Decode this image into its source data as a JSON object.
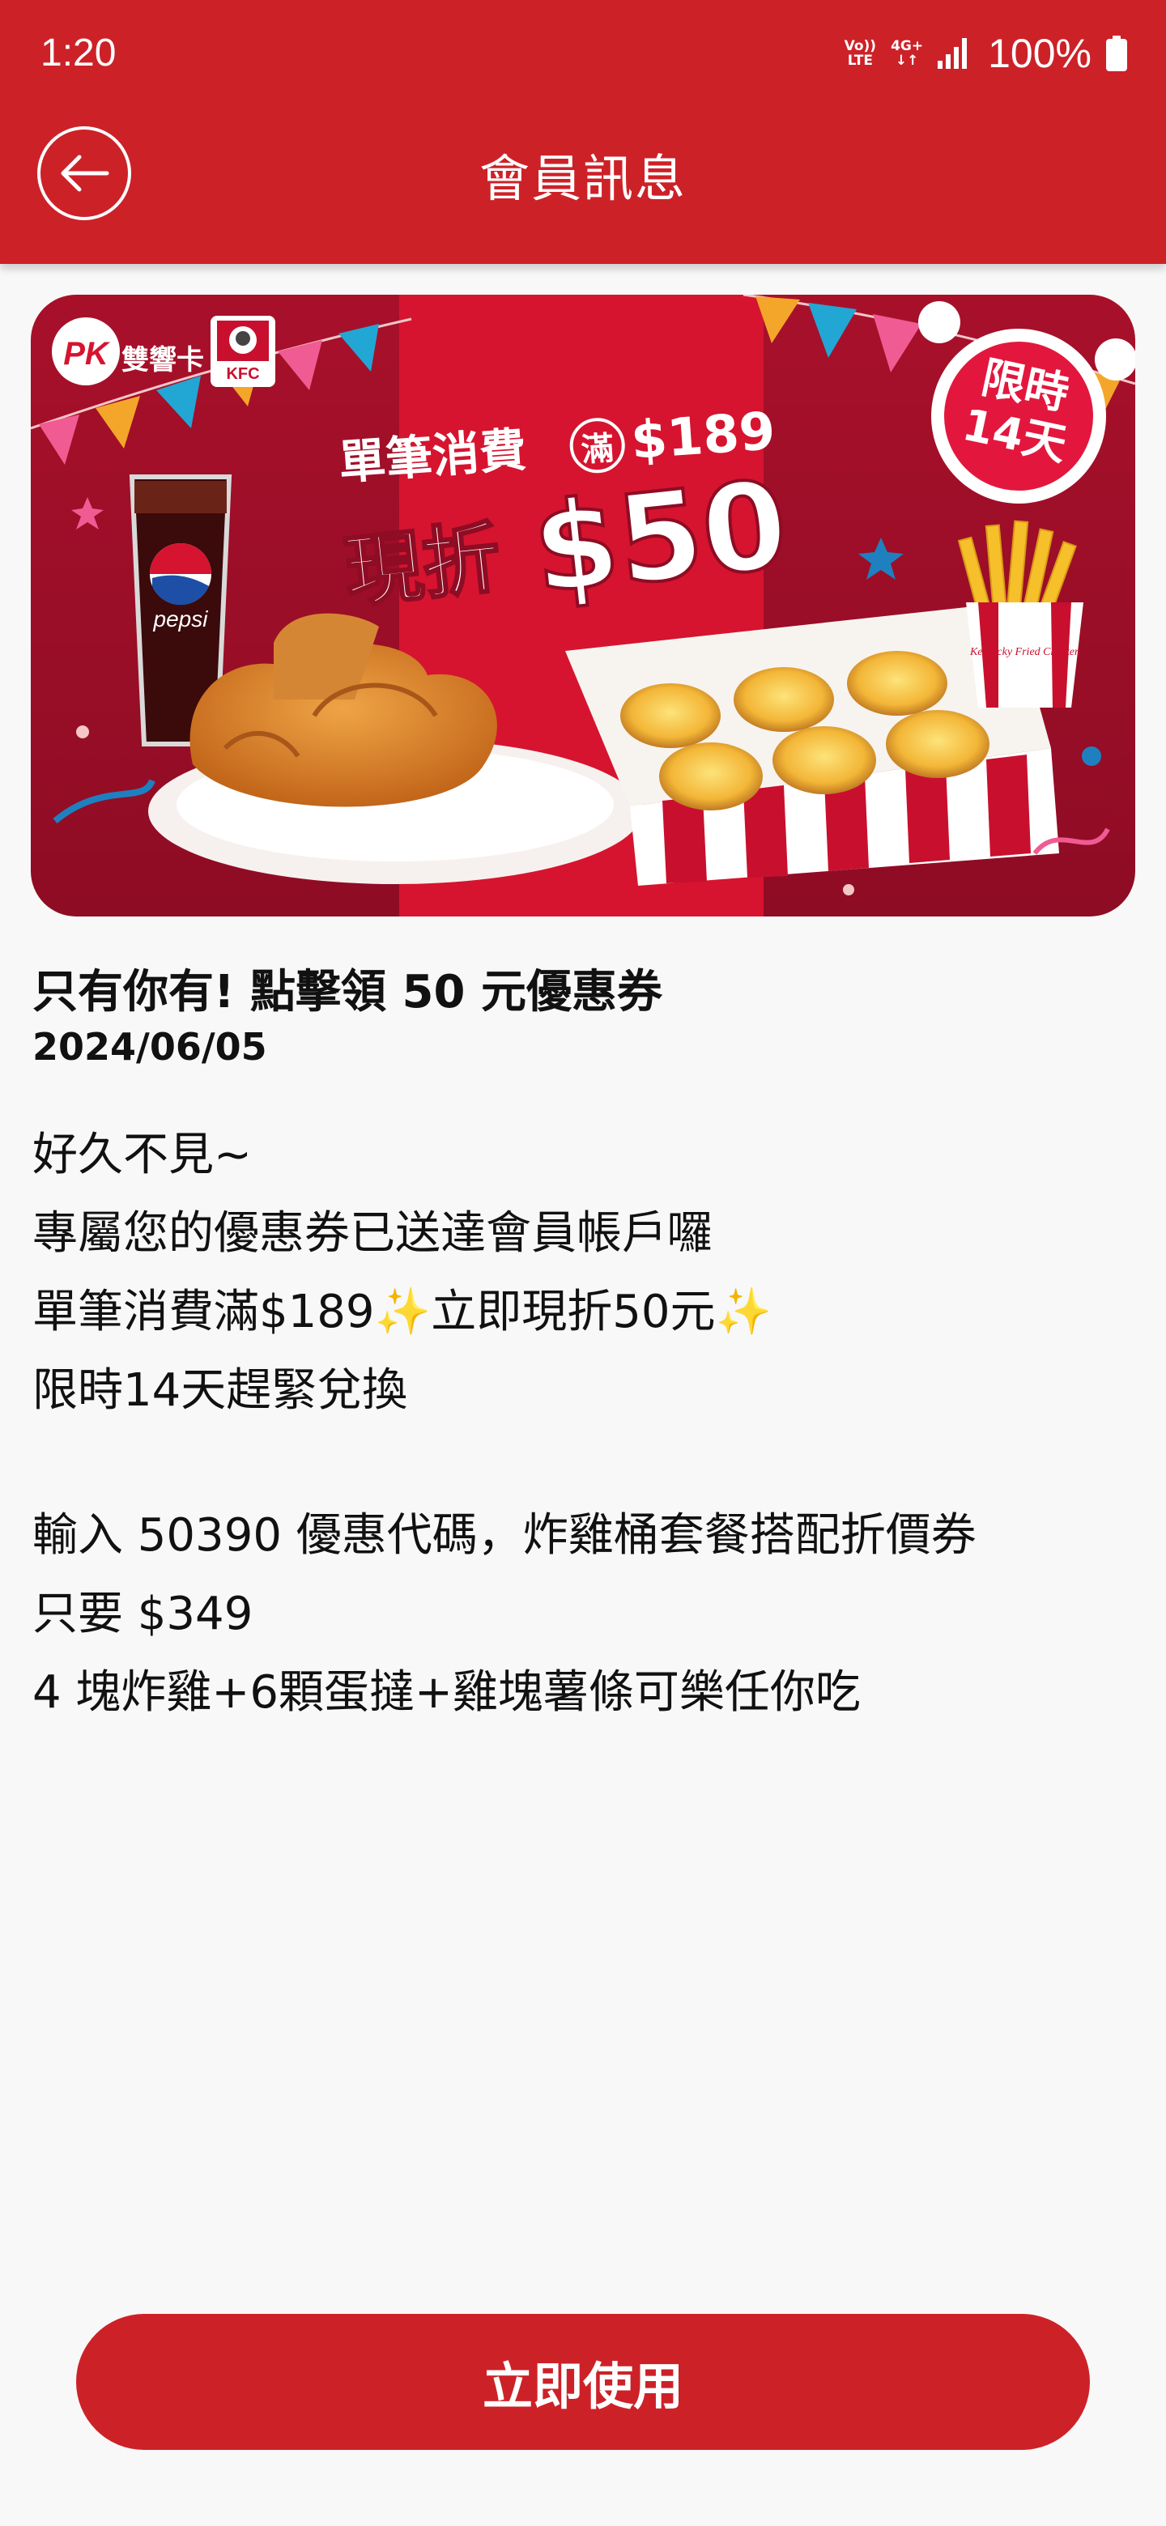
{
  "status_bar": {
    "time": "1:20",
    "volte_top": "Vo))",
    "volte_bottom": "LTE",
    "network_top": "4G+",
    "network_bottom": "↓↑",
    "battery": "100%"
  },
  "toolbar": {
    "title": "會員訊息",
    "back_icon": "back-arrow-circle-icon"
  },
  "banner": {
    "brand_text": "雙響卡",
    "kfc_logo_text": "KFC",
    "headline_1": "單筆消費",
    "headline_1_circle": "滿",
    "headline_1_amount": "$189",
    "headline_2": "現折",
    "headline_2_amount": "$50",
    "badge_line1": "限時",
    "badge_line2": "14天",
    "drink_text": "pepsi",
    "fries_box_text": "Kentucky Fried Chicken"
  },
  "message": {
    "title": "只有你有! 點擊領 50 元優惠券",
    "date": "2024/06/05",
    "body_lines": [
      "好久不見~",
      "專屬您的優惠券已送達會員帳戶囉",
      "單筆消費滿$189✨立即現折50元✨",
      "限時14天趕緊兌換",
      "",
      "輸入 50390 優惠代碼，炸雞桶套餐搭配折價券",
      "只要 $349",
      "4 塊炸雞+6顆蛋撻+雞塊薯條可樂任你吃"
    ]
  },
  "cta": {
    "label": "立即使用"
  },
  "colors": {
    "primary_red": "#cd2128",
    "banner_red": "#c8102e",
    "background": "#f8f8f8"
  }
}
